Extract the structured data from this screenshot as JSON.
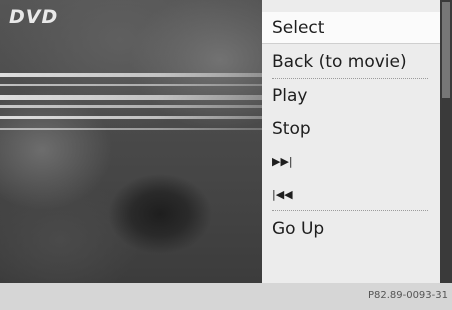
{
  "screen": {
    "source_label": "DVD"
  },
  "menu": {
    "items": [
      {
        "label": "Select",
        "selected": true
      },
      {
        "label": "Back (to movie)"
      },
      {
        "label": "Play"
      },
      {
        "label": "Stop"
      },
      {
        "label": "▶▶|",
        "icon": "next-track-icon"
      },
      {
        "label": "|◀◀",
        "icon": "previous-track-icon"
      },
      {
        "label": "Go Up"
      }
    ]
  },
  "footer": {
    "reference": "P82.89-0093-31"
  }
}
